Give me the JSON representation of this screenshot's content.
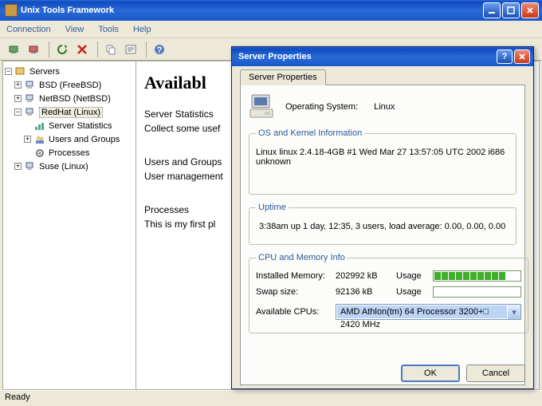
{
  "window": {
    "title": "Unix Tools Framework"
  },
  "menu": {
    "items": [
      "Connection",
      "View",
      "Tools",
      "Help"
    ]
  },
  "tree": {
    "root": "Servers",
    "nodes": [
      {
        "label": "BSD (FreeBSD)",
        "expand": "+"
      },
      {
        "label": "NetBSD (NetBSD)",
        "expand": "+"
      },
      {
        "label": "RedHat (Linux)",
        "expand": "−",
        "selected": true,
        "children": [
          {
            "label": "Server Statistics"
          },
          {
            "label": "Users and Groups",
            "expand": "+"
          },
          {
            "label": "Processes"
          }
        ]
      },
      {
        "label": "Suse (Linux)",
        "expand": "+"
      }
    ]
  },
  "content": {
    "heading": "Availabl",
    "p1a": "Server Statistics",
    "p1b": "Collect some usef",
    "p2a": "Users and Groups",
    "p2b": "User management",
    "p3a": "Processes",
    "p3b": "This is my first pl"
  },
  "status": {
    "text": "Ready"
  },
  "dialog": {
    "title": "Server Properties",
    "tab": "Server Properties",
    "os_label": "Operating System:",
    "os_value": "Linux",
    "group_os": "OS and Kernel Information",
    "os_info": "Linux linux 2.4.18-4GB #1 Wed Mar 27 13:57:05 UTC 2002 i686 unknown",
    "group_uptime": "Uptime",
    "uptime": "3:38am  up 1 day, 12:35,  3 users,  load average: 0.00, 0.00, 0.00",
    "group_cpu": "CPU and Memory Info",
    "mem_label": "Installed Memory:",
    "mem_value": "202992 kB",
    "swap_label": "Swap size:",
    "swap_value": "92136 kB",
    "usage_label": "Usage",
    "cpus_label": "Available CPUs:",
    "cpu_value": "AMD Athlon(tm) 64 Processor 3200+□ 2420 MHz",
    "ok": "OK",
    "cancel": "Cancel"
  }
}
